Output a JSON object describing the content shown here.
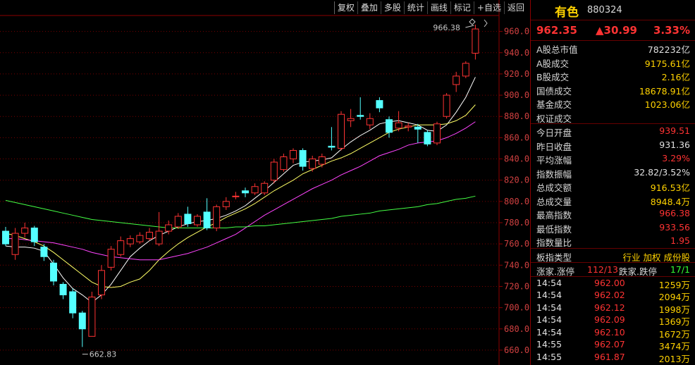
{
  "toolbar": {
    "items": [
      "复权",
      "叠加",
      "多股",
      "统计",
      "画线",
      "标记",
      "+自选",
      "返回"
    ]
  },
  "chart_data": {
    "type": "candlestick",
    "title": "",
    "ylim": [
      650,
      975
    ],
    "yticks": [
      660,
      680,
      700,
      720,
      740,
      760,
      780,
      800,
      820,
      840,
      860,
      880,
      900,
      920,
      940,
      960
    ],
    "up_color": "#ff3333",
    "down_color": "#54ffff",
    "annotations": {
      "high_label": "966.38",
      "low_label": "662.83",
      "high_value": 966.38,
      "low_value": 662.83
    },
    "candles": [
      {
        "o": 772,
        "c": 760,
        "h": 776,
        "l": 758
      },
      {
        "o": 750,
        "c": 770,
        "h": 775,
        "l": 745
      },
      {
        "o": 770,
        "c": 775,
        "h": 780,
        "l": 766
      },
      {
        "o": 775,
        "c": 762,
        "h": 777,
        "l": 758
      },
      {
        "o": 757,
        "c": 748,
        "h": 760,
        "l": 744
      },
      {
        "o": 742,
        "c": 725,
        "h": 745,
        "l": 721
      },
      {
        "o": 722,
        "c": 712,
        "h": 724,
        "l": 708
      },
      {
        "o": 715,
        "c": 695,
        "h": 718,
        "l": 690
      },
      {
        "o": 695,
        "c": 680,
        "h": 697,
        "l": 663
      },
      {
        "o": 673,
        "c": 710,
        "h": 715,
        "l": 673
      },
      {
        "o": 712,
        "c": 735,
        "h": 740,
        "l": 708
      },
      {
        "o": 738,
        "c": 755,
        "h": 758,
        "l": 735
      },
      {
        "o": 750,
        "c": 763,
        "h": 767,
        "l": 748
      },
      {
        "o": 760,
        "c": 765,
        "h": 768,
        "l": 757
      },
      {
        "o": 762,
        "c": 768,
        "h": 771,
        "l": 760
      },
      {
        "o": 765,
        "c": 771,
        "h": 775,
        "l": 763
      },
      {
        "o": 760,
        "c": 772,
        "h": 790,
        "l": 758
      },
      {
        "o": 772,
        "c": 778,
        "h": 782,
        "l": 769
      },
      {
        "o": 776,
        "c": 786,
        "h": 789,
        "l": 774
      },
      {
        "o": 788,
        "c": 779,
        "h": 795,
        "l": 776
      },
      {
        "o": 778,
        "c": 786,
        "h": 788,
        "l": 776
      },
      {
        "o": 790,
        "c": 775,
        "h": 803,
        "l": 773
      },
      {
        "o": 775,
        "c": 795,
        "h": 797,
        "l": 772
      },
      {
        "o": 795,
        "c": 800,
        "h": 804,
        "l": 792
      },
      {
        "o": 805,
        "c": 805,
        "h": 809,
        "l": 802
      },
      {
        "o": 810,
        "c": 808,
        "h": 813,
        "l": 804
      },
      {
        "o": 808,
        "c": 814,
        "h": 817,
        "l": 806
      },
      {
        "o": 808,
        "c": 817,
        "h": 819,
        "l": 806
      },
      {
        "o": 820,
        "c": 837,
        "h": 840,
        "l": 817
      },
      {
        "o": 830,
        "c": 842,
        "h": 845,
        "l": 828
      },
      {
        "o": 840,
        "c": 848,
        "h": 850,
        "l": 836
      },
      {
        "o": 848,
        "c": 833,
        "h": 850,
        "l": 829
      },
      {
        "o": 831,
        "c": 840,
        "h": 843,
        "l": 828
      },
      {
        "o": 835,
        "c": 842,
        "h": 845,
        "l": 832
      },
      {
        "o": 852,
        "c": 851,
        "h": 870,
        "l": 848
      },
      {
        "o": 850,
        "c": 882,
        "h": 885,
        "l": 848
      },
      {
        "o": 876,
        "c": 878,
        "h": 887,
        "l": 870
      },
      {
        "o": 881,
        "c": 880,
        "h": 898,
        "l": 877
      },
      {
        "o": 872,
        "c": 878,
        "h": 883,
        "l": 868
      },
      {
        "o": 895,
        "c": 888,
        "h": 898,
        "l": 884
      },
      {
        "o": 877,
        "c": 865,
        "h": 880,
        "l": 860
      },
      {
        "o": 869,
        "c": 874,
        "h": 885,
        "l": 866
      },
      {
        "o": 870,
        "c": 871,
        "h": 874,
        "l": 866
      },
      {
        "o": 870,
        "c": 868,
        "h": 873,
        "l": 855
      },
      {
        "o": 865,
        "c": 854,
        "h": 867,
        "l": 852
      },
      {
        "o": 855,
        "c": 873,
        "h": 875,
        "l": 853
      },
      {
        "o": 880,
        "c": 900,
        "h": 902,
        "l": 878
      },
      {
        "o": 910,
        "c": 918,
        "h": 922,
        "l": 903
      },
      {
        "o": 918,
        "c": 930,
        "h": 932,
        "l": 916
      },
      {
        "o": 939.51,
        "c": 962.35,
        "h": 966.38,
        "l": 933.56
      }
    ],
    "ma": [
      {
        "name": "",
        "color": "#ffffff",
        "values": [
          758,
          757,
          757,
          756,
          753,
          741,
          728,
          718,
          712,
          705,
          712,
          722,
          735,
          748,
          756,
          763,
          768,
          772,
          776,
          779,
          781,
          782,
          784,
          787,
          791,
          796,
          803,
          810,
          818,
          826,
          834,
          837,
          838,
          839,
          841,
          849,
          856,
          862,
          867,
          873,
          875,
          876,
          874,
          872,
          867,
          866,
          872,
          884,
          898,
          917
        ]
      },
      {
        "name": "",
        "color": "#ffff66",
        "values": [
          770,
          768,
          765,
          762,
          758,
          752,
          745,
          738,
          731,
          724,
          720,
          719,
          720,
          724,
          727,
          735,
          745,
          753,
          760,
          766,
          771,
          776,
          780,
          785,
          789,
          793,
          798,
          804,
          810,
          815,
          820,
          826,
          830,
          834,
          838,
          841,
          845,
          850,
          855,
          860,
          865,
          868,
          870,
          872,
          872,
          872,
          873,
          876,
          881,
          891
        ]
      },
      {
        "name": "",
        "color": "#ff44ff",
        "values": [
          765,
          765,
          764,
          763,
          762,
          761,
          759,
          757,
          755,
          752,
          750,
          748,
          747,
          746,
          745,
          745,
          745,
          747,
          749,
          751,
          754,
          757,
          761,
          765,
          769,
          775,
          781,
          787,
          792,
          797,
          802,
          807,
          812,
          816,
          820,
          825,
          829,
          833,
          838,
          843,
          846,
          849,
          853,
          855,
          856,
          857,
          860,
          864,
          869,
          875
        ]
      },
      {
        "name": "",
        "color": "#44ff44",
        "values": [
          801,
          799,
          797,
          795,
          793,
          791,
          789,
          787,
          785,
          783,
          782,
          781,
          780,
          779,
          778,
          777,
          776,
          775,
          775,
          775,
          775,
          775,
          775,
          775,
          776,
          776,
          777,
          777,
          778,
          779,
          780,
          781,
          782,
          783,
          784,
          786,
          787,
          788,
          789,
          791,
          792,
          793,
          794,
          795,
          797,
          798,
          800,
          802,
          803,
          805
        ]
      }
    ]
  },
  "side": {
    "name": "有色",
    "code": "880324",
    "price": "962.35",
    "change": "▲30.99",
    "pct": "3.33%",
    "stats1": [
      {
        "label": "A股总市值",
        "value": "782232亿",
        "cls": "white"
      },
      {
        "label": "A股成交",
        "value": "9175.61亿",
        "cls": ""
      },
      {
        "label": "B股成交",
        "value": "2.16亿",
        "cls": ""
      },
      {
        "label": "国债成交",
        "value": "18678.91亿",
        "cls": ""
      },
      {
        "label": "基金成交",
        "value": "1023.06亿",
        "cls": ""
      },
      {
        "label": "权证成交",
        "value": "",
        "cls": ""
      }
    ],
    "stats2": [
      {
        "label": "今日开盘",
        "value": "939.51",
        "cls": "red"
      },
      {
        "label": "昨日收盘",
        "value": "931.36",
        "cls": "white"
      },
      {
        "label": "平均涨幅",
        "value": "3.29%",
        "cls": "red"
      },
      {
        "label": "指数振幅",
        "value": "32.82/3.52%",
        "cls": "white"
      },
      {
        "label": "总成交额",
        "value": "916.53亿",
        "cls": ""
      },
      {
        "label": "总成交量",
        "value": "8948.4万",
        "cls": ""
      },
      {
        "label": "最高指数",
        "value": "966.38",
        "cls": "red"
      },
      {
        "label": "最低指数",
        "value": "933.56",
        "cls": "red"
      },
      {
        "label": "指数量比",
        "value": "1.95",
        "cls": "red"
      }
    ],
    "board_label": "板指类型",
    "board_value": "行业 加权 成份股",
    "updown_label1": "涨家.涨停",
    "updown_value1": "112/13",
    "updown_label2": "跌家.跌停",
    "updown_value2": "17/1",
    "ticks": [
      {
        "t": "14:54",
        "p": "962.00",
        "v": "1259万"
      },
      {
        "t": "14:54",
        "p": "962.02",
        "v": "2094万"
      },
      {
        "t": "14:54",
        "p": "962.12",
        "v": "1998万"
      },
      {
        "t": "14:54",
        "p": "962.09",
        "v": "1369万"
      },
      {
        "t": "14:54",
        "p": "962.10",
        "v": "1672万"
      },
      {
        "t": "14:55",
        "p": "962.07",
        "v": "3474万"
      },
      {
        "t": "14:55",
        "p": "961.87",
        "v": "2013万"
      }
    ]
  }
}
